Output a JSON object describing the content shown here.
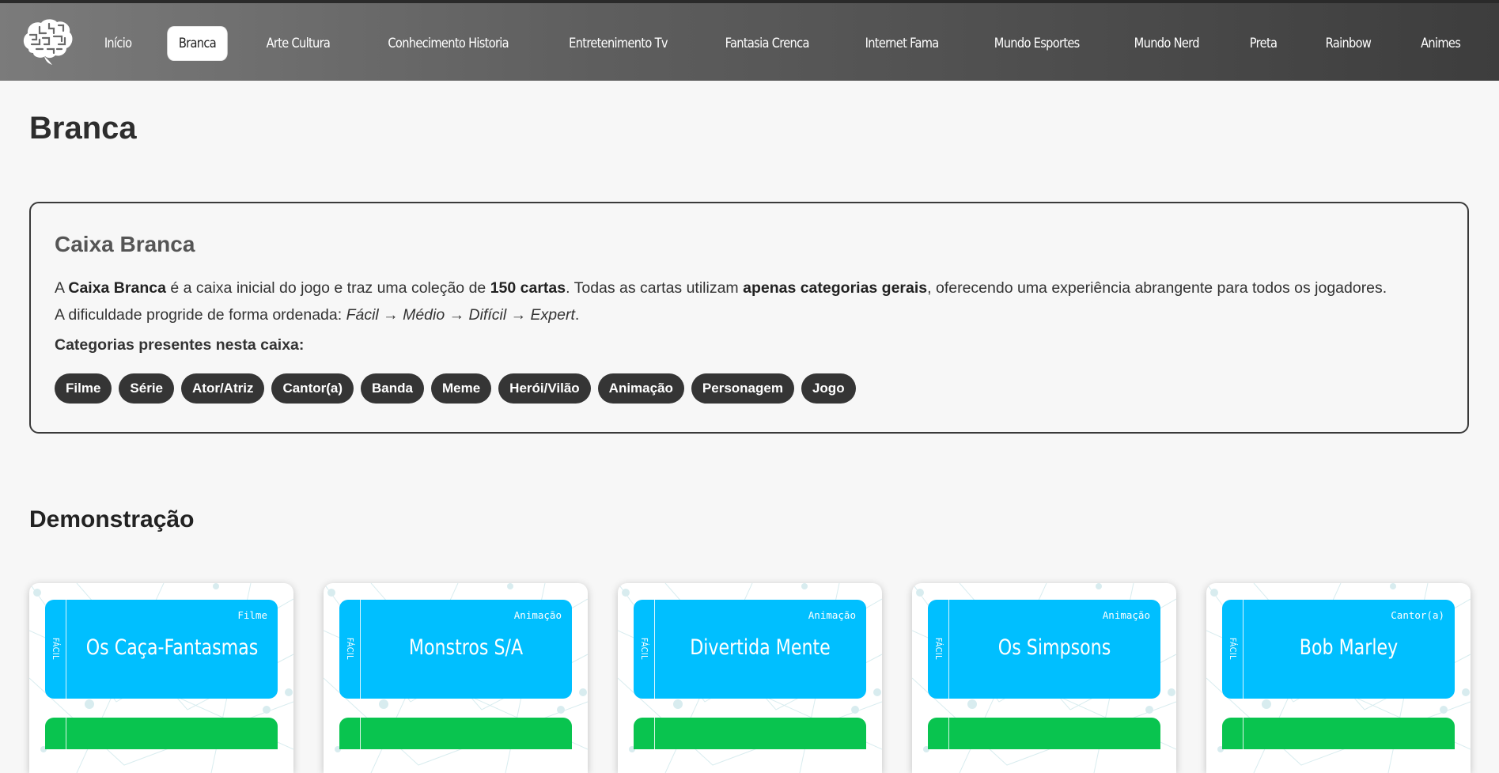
{
  "nav": {
    "items": [
      "Início",
      "Branca",
      "Arte Cultura",
      "Conhecimento Historia",
      "Entretenimento Tv",
      "Fantasia Crenca",
      "Internet Fama",
      "Mundo Esportes",
      "Mundo Nerd",
      "Preta",
      "Rainbow",
      "Animes"
    ],
    "active": "Branca"
  },
  "page": {
    "title": "Branca"
  },
  "box": {
    "title": "Caixa Branca",
    "p1_a": "A ",
    "p1_b": "Caixa Branca",
    "p1_c": " é a caixa inicial do jogo e traz uma coleção de ",
    "p1_d": "150 cartas",
    "p1_e": ". Todas as cartas utilizam ",
    "p1_f": "apenas categorias gerais",
    "p1_g": ", oferecendo uma experiência abrangente para todos os jogadores.",
    "p2_a": "A dificuldade progride de forma ordenada: ",
    "p2_b": "Fácil → Médio → Difícil → Expert",
    "p2_c": ".",
    "categories_label": "Categorias presentes nesta caixa:",
    "categories": [
      "Filme",
      "Série",
      "Ator/Atriz",
      "Cantor(a)",
      "Banda",
      "Meme",
      "Herói/Vilão",
      "Animação",
      "Personagem",
      "Jogo"
    ]
  },
  "demo": {
    "title": "Demonstração",
    "cards": [
      {
        "difficulty": "FÁCIL",
        "category": "Filme",
        "name": "Os Caça-Fantasmas"
      },
      {
        "difficulty": "FÁCIL",
        "category": "Animação",
        "name": "Monstros S/A"
      },
      {
        "difficulty": "FÁCIL",
        "category": "Animação",
        "name": "Divertida Mente"
      },
      {
        "difficulty": "FÁCIL",
        "category": "Animação",
        "name": "Os Simpsons"
      },
      {
        "difficulty": "FÁCIL",
        "category": "Cantor(a)",
        "name": "Bob Marley"
      }
    ]
  },
  "colors": {
    "card_top": "#00bfff",
    "card_bottom": "#09c44f",
    "tag_bg": "#353535",
    "nav_dark": "#3d3d3d"
  },
  "icons": {
    "logo": "brain-logo-icon"
  }
}
